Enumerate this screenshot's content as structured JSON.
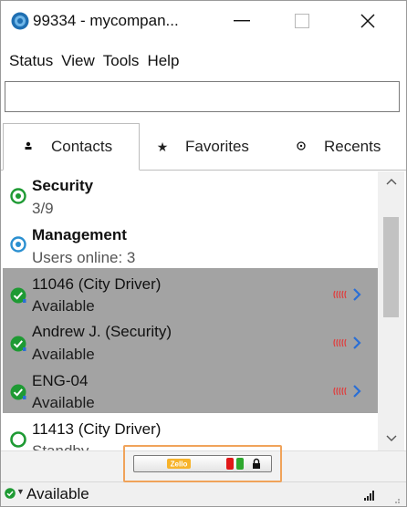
{
  "window": {
    "title": "99334 - mycompan...",
    "minimize_glyph": "—",
    "maximize_glyph": "☐",
    "close_glyph": "✕"
  },
  "menu": [
    "Status",
    "View",
    "Tools",
    "Help"
  ],
  "search": {
    "value": "",
    "placeholder": ""
  },
  "tabs": [
    {
      "label": "Contacts",
      "icon": "person-icon",
      "glyph": "♟"
    },
    {
      "label": "Favorites",
      "icon": "star-icon",
      "glyph": "★"
    },
    {
      "label": "Recents",
      "icon": "clock-icon",
      "glyph": "◎"
    }
  ],
  "contacts": [
    {
      "name": "Security",
      "sub": "3/9",
      "type": "channel",
      "status": "online-channel"
    },
    {
      "name": "Management",
      "sub": "Users online: 3",
      "type": "channel",
      "status": "online-channel-blue"
    },
    {
      "name": "11046 (City Driver)",
      "sub": "Available",
      "type": "user",
      "status": "available"
    },
    {
      "name": "Andrew J. (Security)",
      "sub": "Available",
      "type": "user",
      "status": "available"
    },
    {
      "name": "ENG-04",
      "sub": "Available",
      "type": "user",
      "status": "available"
    },
    {
      "name": "11413 (City Driver)",
      "sub": "Standby",
      "type": "user",
      "status": "standby"
    }
  ],
  "ptt": {
    "logo_text": "Zello"
  },
  "statusbar": {
    "status_label": "Available"
  },
  "colors": {
    "accent_green": "#1e9a33",
    "accent_blue": "#2a8fd0",
    "selected_bg": "#a3a3a3",
    "highlight_orange": "#f0a35a",
    "talk_red": "#e23a3a",
    "chevron_blue": "#2a6fd6"
  }
}
